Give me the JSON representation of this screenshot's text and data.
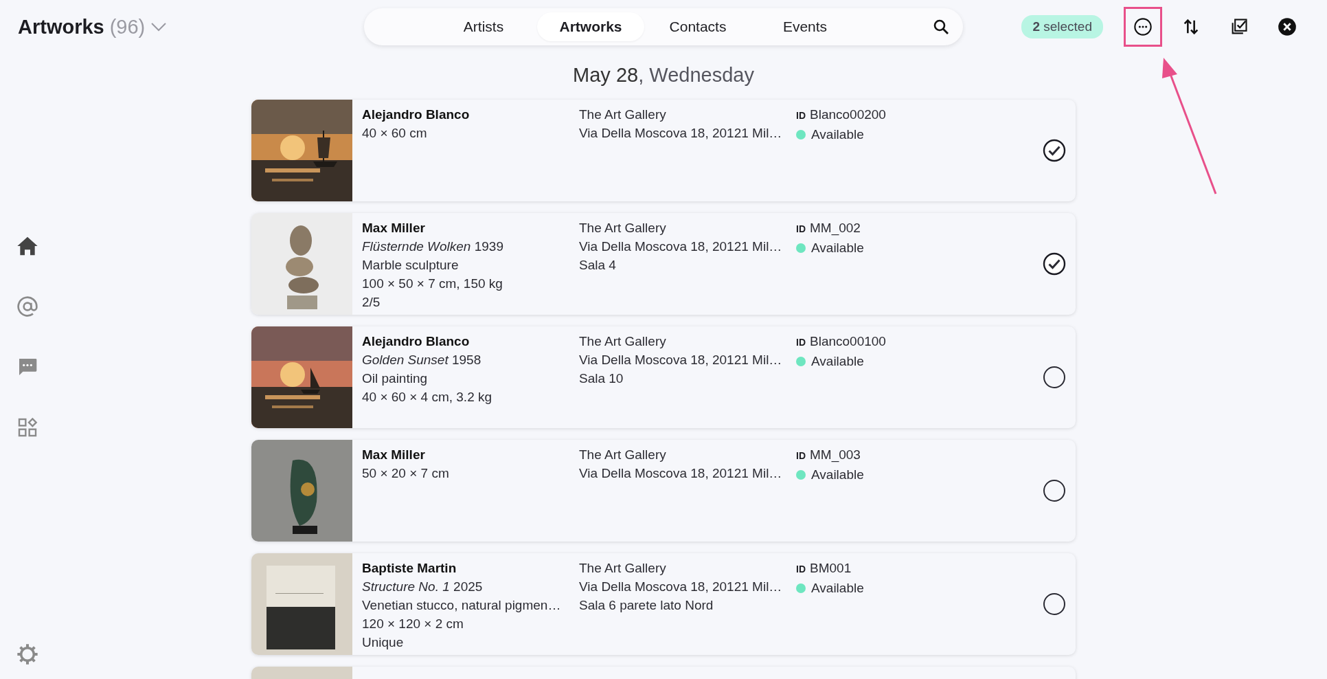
{
  "header": {
    "title": "Artworks",
    "count": "(96)"
  },
  "nav": {
    "tabs": [
      {
        "label": "Artists",
        "selected": false
      },
      {
        "label": "Artworks",
        "selected": true
      },
      {
        "label": "Contacts",
        "selected": false
      },
      {
        "label": "Events",
        "selected": false
      }
    ]
  },
  "selection_badge": "2 selected",
  "actions": [
    {
      "kind": "more",
      "highlighted": true
    },
    {
      "kind": "sort",
      "highlighted": false
    },
    {
      "kind": "select_all",
      "highlighted": false
    },
    {
      "kind": "close",
      "highlighted": false
    }
  ],
  "sidebar": {
    "items": [
      {
        "kind": "home",
        "selected": true
      },
      {
        "kind": "mentions",
        "selected": false
      },
      {
        "kind": "messages",
        "selected": false
      },
      {
        "kind": "apps",
        "selected": false
      }
    ]
  },
  "date": {
    "day": "May 28",
    "weekday": ", Wednesday"
  },
  "cards": [
    {
      "artist": "Alejandro Blanco",
      "lines": [
        "40 × 60 cm"
      ],
      "venue": "The Art Gallery",
      "address": "Via Della Moscova 18, 20121 Mil…",
      "id_label": "ID",
      "id": "Blanco00200",
      "status": "Available",
      "selected": true
    },
    {
      "artist": "Max Miller",
      "lines": [
        "*Flüsternde Wolken* 1939",
        "Marble sculpture",
        "100 × 50 × 7 cm, 150 kg",
        "2/5"
      ],
      "venue": "The Art Gallery",
      "address": "Via Della Moscova 18, 20121 Mil…",
      "room": "Sala 4",
      "id_label": "ID",
      "id": "MM_002",
      "status": "Available",
      "selected": true
    },
    {
      "artist": "Alejandro Blanco",
      "lines": [
        "*Golden Sunset* 1958",
        "Oil painting",
        "40 × 60 × 4 cm, 3.2 kg"
      ],
      "venue": "The Art Gallery",
      "address": "Via Della Moscova 18, 20121 Mil…",
      "room": "Sala 10",
      "id_label": "ID",
      "id": "Blanco00100",
      "status": "Available",
      "selected": false
    },
    {
      "artist": "Max Miller",
      "lines": [
        "50 × 20 × 7 cm"
      ],
      "venue": "The Art Gallery",
      "address": "Via Della Moscova 18, 20121 Mil…",
      "id_label": "ID",
      "id": "MM_003",
      "status": "Available",
      "selected": false
    },
    {
      "artist": "Baptiste Martin",
      "lines": [
        "*Structure No. 1* 2025",
        "Venetian stucco, natural pigmen…",
        "120 × 120 × 2 cm",
        "Unique"
      ],
      "venue": "The Art Gallery",
      "address": "Via Della Moscova 18, 20121 Mil…",
      "room": "Sala 6 parete lato Nord",
      "id_label": "ID",
      "id": "BM001",
      "status": "Available",
      "selected": false
    },
    {
      "kind": "partial"
    }
  ]
}
